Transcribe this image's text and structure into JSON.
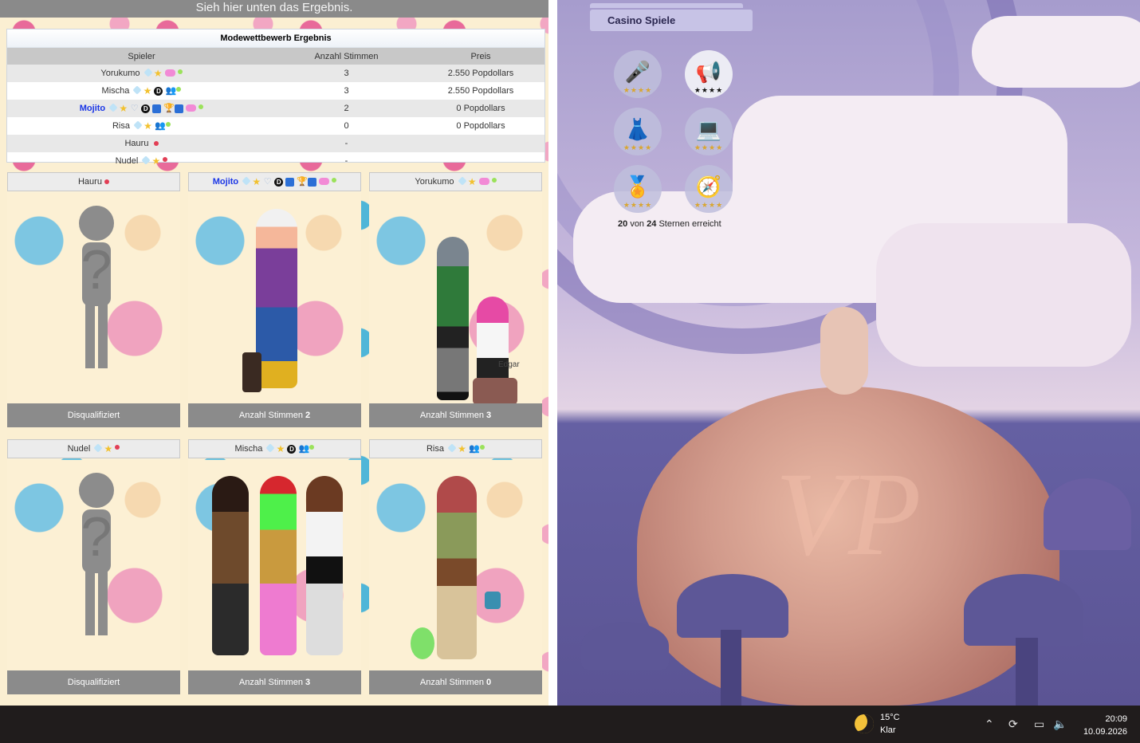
{
  "top_message": "Sieh hier unten das Ergebnis.",
  "results": {
    "title": "Modewettbewerb Ergebnis",
    "headers": [
      "Spieler",
      "Anzahl Stimmen",
      "Preis"
    ],
    "rows": [
      {
        "name": "Yorukumo",
        "votes": "3",
        "prize": "2.550 Popdollars"
      },
      {
        "name": "Mischa",
        "votes": "3",
        "prize": "2.550 Popdollars"
      },
      {
        "name": "Mojito",
        "votes": "2",
        "prize": "0 Popdollars"
      },
      {
        "name": "Risa",
        "votes": "0",
        "prize": "0 Popdollars"
      },
      {
        "name": "Hauru",
        "votes": "-",
        "prize": ""
      },
      {
        "name": "Nudel",
        "votes": "-",
        "prize": ""
      }
    ]
  },
  "cards": [
    {
      "name": "Hauru",
      "status": "Disqualifiziert"
    },
    {
      "name": "Mojito",
      "votes_label": "Anzahl Stimmen",
      "votes": "2"
    },
    {
      "name": "Yorukumo",
      "votes_label": "Anzahl Stimmen",
      "votes": "3",
      "pet_name": "Edgar"
    },
    {
      "name": "Nudel",
      "status": "Disqualifiziert"
    },
    {
      "name": "Mischa",
      "votes_label": "Anzahl Stimmen",
      "votes": "3"
    },
    {
      "name": "Risa",
      "votes_label": "Anzahl Stimmen",
      "votes": "0"
    }
  ],
  "right_panel": {
    "tab_label": "Casino Spiele",
    "badges": [
      {
        "icon": "microphone-icon",
        "stars": "★★★★"
      },
      {
        "icon": "megaphone-icon",
        "stars": "★★★★"
      },
      {
        "icon": "dress-icon",
        "stars": "★★★★"
      },
      {
        "icon": "laptop-icon",
        "stars": "★★★★"
      },
      {
        "icon": "medal-icon",
        "stars": "★★★★"
      },
      {
        "icon": "compass-icon",
        "stars": "★★★★"
      }
    ],
    "stars_summary": {
      "achieved": "20",
      "of_word": "von",
      "total": "24",
      "suffix": "Sternen erreicht"
    }
  },
  "taskbar": {
    "temperature": "15°C",
    "condition": "Klar",
    "time": "20:09",
    "date": "10.09.2026"
  }
}
